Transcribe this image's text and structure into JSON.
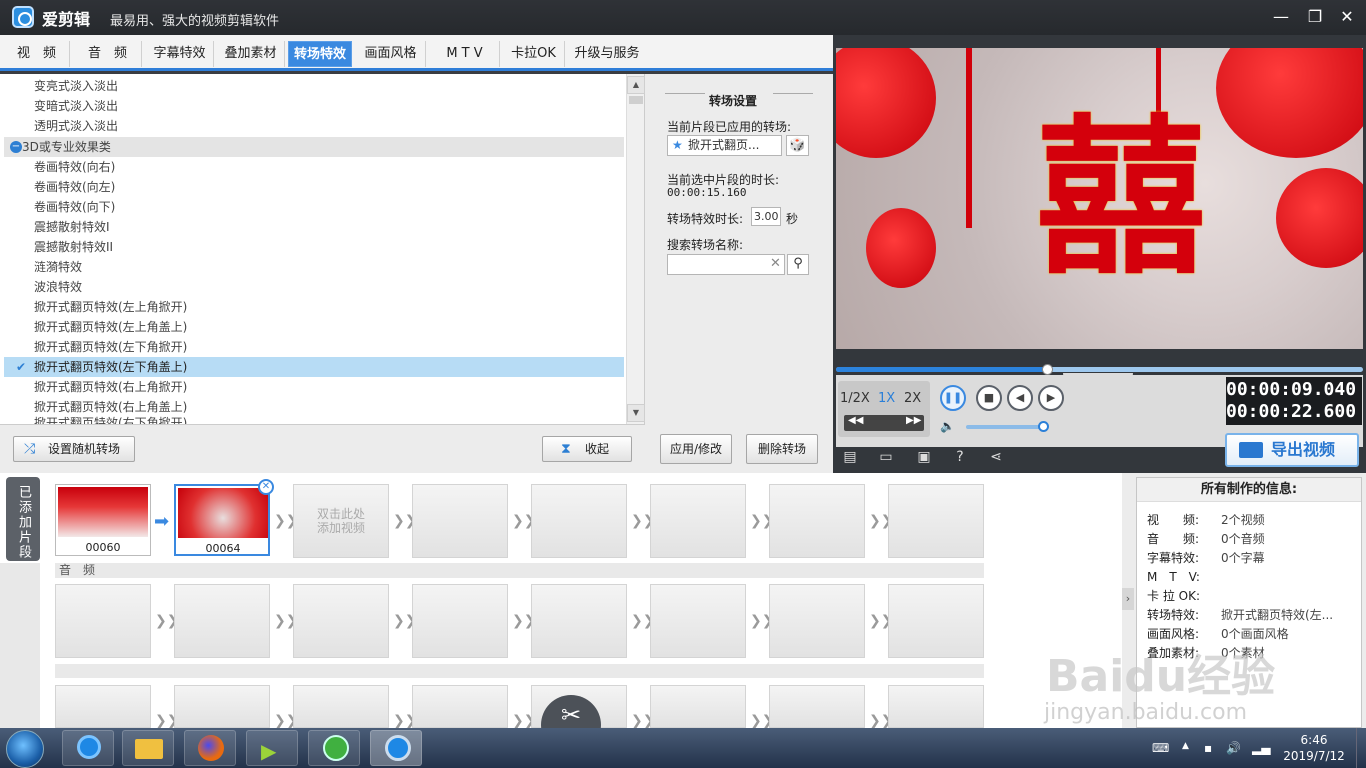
{
  "app": {
    "name": "爱剪辑",
    "slogan": "最易用、强大的视频剪辑软件"
  },
  "tabs": [
    "视　频",
    "音　频",
    "字幕特效",
    "叠加素材",
    "转场特效",
    "画面风格",
    "M T V",
    "卡拉OK",
    "升级与服务"
  ],
  "active_tab": "转场特效",
  "list": {
    "items_top": [
      "变亮式淡入淡出",
      "变暗式淡入淡出",
      "透明式淡入淡出"
    ],
    "category": "3D或专业效果类",
    "items": [
      "卷画特效(向右)",
      "卷画特效(向左)",
      "卷画特效(向下)",
      "震撼散射特效I",
      "震撼散射特效II",
      "涟漪特效",
      "波浪特效",
      "掀开式翻页特效(左上角掀开)",
      "掀开式翻页特效(左上角盖上)",
      "掀开式翻页特效(左下角掀开)"
    ],
    "selected": "掀开式翻页特效(左下角盖上)",
    "items_after": [
      "掀开式翻页特效(右上角掀开)",
      "掀开式翻页特效(右上角盖上)"
    ],
    "partial": "掀开式翻页特效(右下角掀开)",
    "random_btn": "设置随机转场",
    "collapse_btn": "收起"
  },
  "settings": {
    "title": "转场设置",
    "applied_label": "当前片段已应用的转场:",
    "applied_value": "掀开式翻页...",
    "duration_label": "当前选中片段的时长:",
    "duration_value": "00:00:15.160",
    "effect_dur_label": "转场特效时长:",
    "effect_dur_value": "3.00",
    "effect_dur_unit": "秒",
    "search_label": "搜索转场名称:",
    "search_value": "",
    "apply_btn": "应用/修改",
    "delete_btn": "删除转场"
  },
  "preview": {
    "progress": 0.4,
    "speeds": [
      "1/2X",
      "1X",
      "2X"
    ],
    "active_speed": "1X",
    "time_current": "00:00:09.040",
    "time_total": "00:00:22.600",
    "volume": 0.8,
    "export_btn": "导出视频"
  },
  "timeline": {
    "side_label": "已添加片段",
    "clips": [
      {
        "label": "00060"
      },
      {
        "label": "00064"
      }
    ],
    "add_hint_1": "双击此处",
    "add_hint_2": "添加视频",
    "audio_label": "音　频"
  },
  "info": {
    "title": "所有制作的信息:",
    "rows": [
      {
        "k": "视　　频:",
        "v": "2个视频"
      },
      {
        "k": "音　　频:",
        "v": "0个音频"
      },
      {
        "k": "字幕特效:",
        "v": "0个字幕"
      },
      {
        "k": "M　T　V:",
        "v": ""
      },
      {
        "k": "卡 拉 OK:",
        "v": ""
      },
      {
        "k": "转场特效:",
        "v": "掀开式翻页特效(左..."
      },
      {
        "k": "画面风格:",
        "v": "0个画面风格"
      },
      {
        "k": "叠加素材:",
        "v": "0个素材"
      }
    ]
  },
  "taskbar": {
    "time": "6:46",
    "date": "2019/7/12"
  },
  "watermark": {
    "line1": "Baidu经验",
    "line2": "jingyan.baidu.com"
  },
  "colors": {
    "accent": "#3a89e0",
    "title_bg": "#2f3237"
  }
}
